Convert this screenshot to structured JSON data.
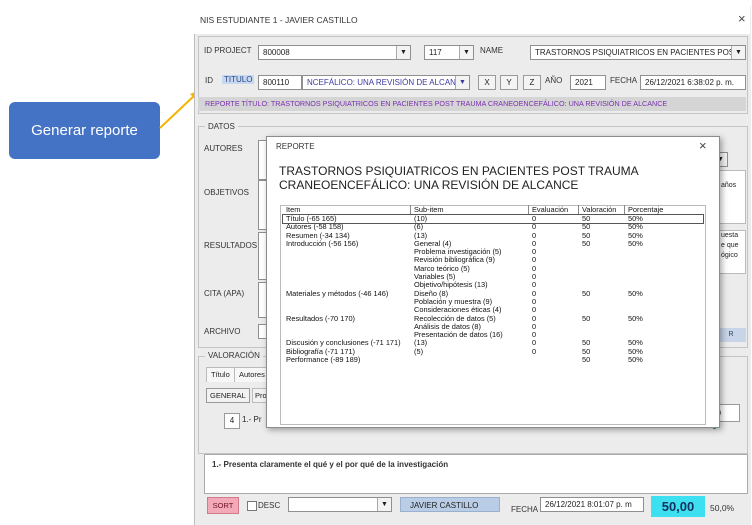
{
  "callout": {
    "label": "Generar reporte"
  },
  "window": {
    "title": "NIS ESTUDIANTE 1 -  JAVIER CASTILLO",
    "close": "×"
  },
  "header": {
    "id_project_label": "ID PROJECT",
    "id_project_value": "800008",
    "num_value": "117",
    "name_label": "NAME",
    "name_value": "TRASTORNOS PSIQUIATRICOS EN PACIENTES POST TR",
    "id_label": "ID",
    "titulo_label": "TITULO",
    "titulo_id": "800110",
    "titulo_value": "NCEFÁLICO: UNA REVISIÓN DE ALCANCE",
    "x_label": "X",
    "y_label": "Y",
    "z_label": "Z",
    "anio_label": "AÑO",
    "anio_value": "2021",
    "fecha_label": "FECHA",
    "fecha_value": "26/12/2021 6:38:02 p. m.",
    "reporte_line": "REPORTE TÍTULO: TRASTORNOS PSIQUIATRICOS EN PACIENTES POST TRAUMA CRANEOENCEFÁLICO: UNA REVISIÓN DE ALCANCE"
  },
  "datos": {
    "group_label": "DATOS",
    "autores_label": "AUTORES",
    "objetivos_label": "OBJETIVOS",
    "resultados_label": "RESULTADOS",
    "cita_label": "CITA (APA)",
    "archivo_label": "ARCHIVO",
    "right_snippet_1": "años",
    "right_snippet_2": "uesta",
    "right_snippet_3": "e que",
    "right_snippet_4": "ógico",
    "right_snippet_5": "R"
  },
  "valoracion": {
    "group_label": "VALORACIÓN",
    "tab_titulo": "Título",
    "tab_autores": "Autores",
    "general_label": "GENERAL",
    "pro_label": "Pro",
    "row_num": "4",
    "row_text": "1.- Pr",
    "right_val": "00",
    "right_val2": "0"
  },
  "bottom": {
    "question": "1.- Presenta claramente el qué y el por qué de la investigación",
    "sort_label": "SORT",
    "desc_label": "DESC",
    "student": "JAVIER CASTILLO",
    "fecha_label": "FECHA",
    "fecha_value": "26/12/2021 8:01:07 p. m",
    "score": "50,00",
    "percent": "50,0%"
  },
  "report": {
    "window_title": "REPORTE",
    "close": "×",
    "title_line1": "TRASTORNOS PSIQUIATRICOS EN PACIENTES POST TRAUMA",
    "title_line2": "CRANEOENCEFÁLICO: UNA REVISIÓN DE ALCANCE",
    "columns": [
      "Item",
      "Sub-item",
      "Evaluación",
      "Valoración",
      "Porcentaje"
    ],
    "rows": [
      [
        "Título (-65 165)",
        "(10)",
        "0",
        "50",
        "50%"
      ],
      [
        "Autores (-58 158)",
        "(6)",
        "0",
        "50",
        "50%"
      ],
      [
        "Resumen (-34 134)",
        "(13)",
        "0",
        "50",
        "50%"
      ],
      [
        "Introducción (-56 156)",
        "General (4)",
        "0",
        "50",
        "50%"
      ],
      [
        "",
        "Problema investigación (5)",
        "0",
        "",
        ""
      ],
      [
        "",
        "Revisión bibliográfica (9)",
        "0",
        "",
        ""
      ],
      [
        "",
        "Marco teórico (5)",
        "0",
        "",
        ""
      ],
      [
        "",
        "Variables (5)",
        "0",
        "",
        ""
      ],
      [
        "",
        "Objetivo/hipótesis (13)",
        "0",
        "",
        ""
      ],
      [
        "Materiales y métodos (-46 146)",
        "Diseño (8)",
        "0",
        "50",
        "50%"
      ],
      [
        "",
        "Población y muestra (9)",
        "0",
        "",
        ""
      ],
      [
        "",
        "Consideraciones éticas (4)",
        "0",
        "",
        ""
      ],
      [
        "Resultados (-70 170)",
        "Recolección de datos (5)",
        "0",
        "50",
        "50%"
      ],
      [
        "",
        "Análisis de datos (8)",
        "0",
        "",
        ""
      ],
      [
        "",
        "Presentación de datos (16)",
        "0",
        "",
        ""
      ],
      [
        "Discusión y conclusiones (-71 171)",
        "(13)",
        "0",
        "50",
        "50%"
      ],
      [
        "Bibliografía (-71 171)",
        "(5)",
        "0",
        "50",
        "50%"
      ],
      [
        "Performance (-89 189)",
        "",
        "",
        "50",
        "50%"
      ]
    ]
  },
  "colors": {
    "callout": "#4472c4",
    "reporte_text": "#7a2fb0",
    "sort_bg": "#f4a9b8",
    "score_bg": "#3ce0f0",
    "student_bg": "#b9cde6"
  }
}
